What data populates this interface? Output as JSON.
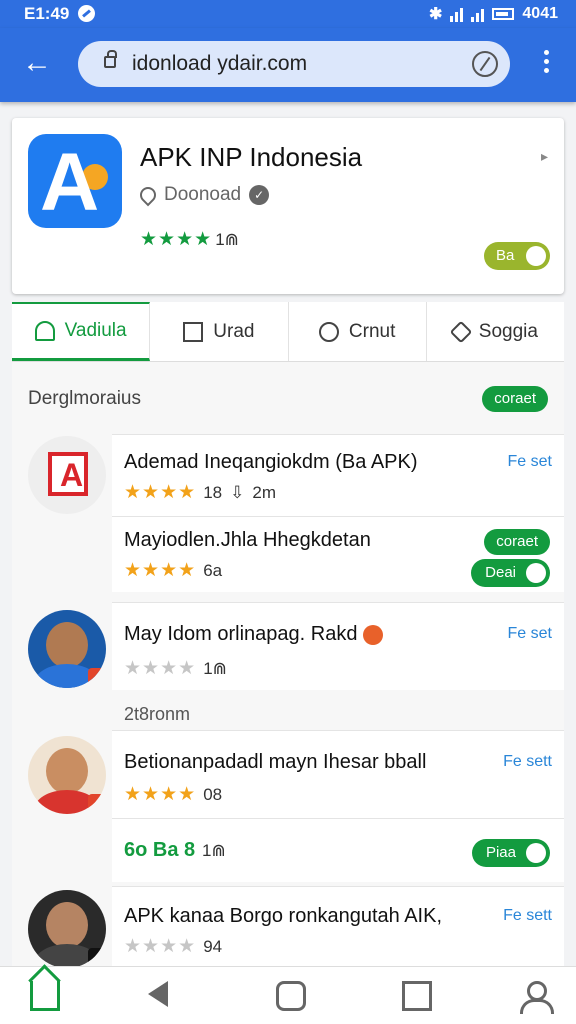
{
  "status": {
    "time": "E1:49",
    "right_text": "4041"
  },
  "browser": {
    "url": "idonload ydair.com"
  },
  "app_card": {
    "title": "APK INP Indonesia",
    "subtitle": "Doonoad",
    "rating_text": "1⋒",
    "action_label": "Ba"
  },
  "tabs": [
    {
      "label": "Vadiula"
    },
    {
      "label": "Urad"
    },
    {
      "label": "Crnut"
    },
    {
      "label": "Soggia"
    }
  ],
  "list": {
    "section_title": "Derglmoraius",
    "section_badge": "coraet",
    "items": [
      {
        "title": "Ademad Ineqangiokdm (Ba APK)",
        "link": "Fe set",
        "rating": "18",
        "extra": "2m"
      },
      {
        "title": "Mayiodlen.Jhla Hhegkdetan",
        "badge": "coraet",
        "rating": "6a",
        "action": "Deai"
      },
      {
        "title": "May Idom orlinapag. Rakd",
        "link": "Fe set",
        "rating": "1⋒"
      },
      {
        "separator": "2t8ronm"
      },
      {
        "title": "Betionanpadadl mayn Ihesar bball",
        "link": "Fe sett",
        "rating": "08"
      },
      {
        "green_text": "6o Ba 8",
        "rating": "1⋒",
        "action": "Piaa"
      },
      {
        "title": "APK kanaa Borgo ronkangutah AIK,",
        "link": "Fe sett",
        "rating": "94"
      }
    ]
  },
  "colors": {
    "primary": "#2f6fe0",
    "green": "#139b3f",
    "star": "#f2a21a"
  }
}
